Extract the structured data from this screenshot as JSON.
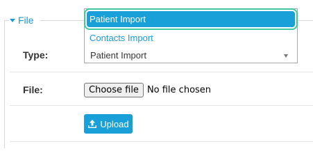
{
  "fieldset": {
    "legend": "File"
  },
  "form": {
    "type_label": "Type:",
    "file_label": "File:",
    "type_select": {
      "selected_value": "Patient Import",
      "options": [
        "Patient Import",
        "Contacts Import"
      ],
      "highlighted_option": "Patient Import"
    },
    "file_input": {
      "button_label": "Choose file",
      "status_text": "No file chosen"
    },
    "upload_button": {
      "label": "Upload",
      "icon": "upload-icon"
    }
  },
  "colors": {
    "accent": "#1aa0d8",
    "focus_ring": "#3fc8a0",
    "link": "#1a9bd7"
  }
}
